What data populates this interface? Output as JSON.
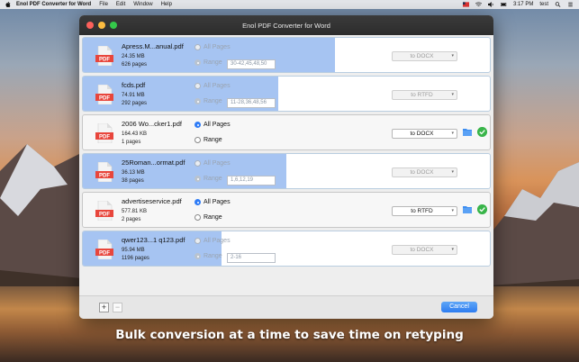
{
  "menubar": {
    "items": [
      "Enol PDF Converter for Word",
      "File",
      "Edit",
      "Window",
      "Help"
    ],
    "clock": "3:17 PM",
    "user": "test"
  },
  "window": {
    "title": "Enol PDF Converter for Word"
  },
  "labels": {
    "all_pages": "All Pages",
    "range": "Range"
  },
  "files": [
    {
      "name": "Apress.M...anual.pdf",
      "size": "24.35 MB",
      "pages": "626 pages",
      "mode": "range",
      "range_value": "30-42,45,48,50",
      "target": "to DOCX",
      "status": "converting",
      "progress": 0.62
    },
    {
      "name": "fcds.pdf",
      "size": "74.91 MB",
      "pages": "292 pages",
      "mode": "range",
      "range_value": "11-28,36,48,56",
      "target": "to RTFD",
      "status": "converting",
      "progress": 0.48
    },
    {
      "name": "2006 Wo...cker1.pdf",
      "size": "164.43 KB",
      "pages": "1 pages",
      "mode": "all",
      "range_value": "",
      "target": "to DOCX",
      "status": "done",
      "progress": 1.0
    },
    {
      "name": "25Roman...ormat.pdf",
      "size": "36.13 MB",
      "pages": "38 pages",
      "mode": "range",
      "range_value": "1,6,12,19",
      "target": "to DOCX",
      "status": "converting",
      "progress": 0.5
    },
    {
      "name": "advertiseservice.pdf",
      "size": "577.81 KB",
      "pages": "2 pages",
      "mode": "all",
      "range_value": "",
      "target": "to RTFD",
      "status": "done",
      "progress": 1.0
    },
    {
      "name": "qwer123...1 q123.pdf",
      "size": "95.94 MB",
      "pages": "1196 pages",
      "mode": "range",
      "range_value": "2-16",
      "target": "to DOCX",
      "status": "converting",
      "progress": 0.34
    }
  ],
  "bottombar": {
    "add_label": "+",
    "remove_label": "−",
    "cancel_label": "Cancel"
  },
  "caption": "Bulk conversion at a time to save time on retyping",
  "colors": {
    "accent": "#2f7cf6",
    "progress": "#5d94e8",
    "done": "#39b54a",
    "pdf_red": "#e8463c"
  }
}
